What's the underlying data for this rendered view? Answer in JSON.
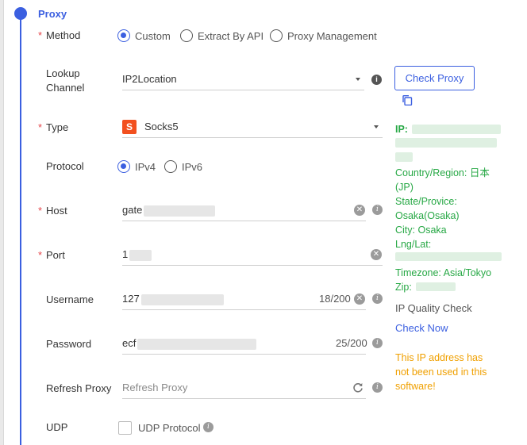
{
  "section": {
    "title": "Proxy"
  },
  "method": {
    "label": "Method",
    "options": [
      "Custom",
      "Extract By API",
      "Proxy Management"
    ],
    "selected": "Custom"
  },
  "lookup": {
    "label_line1": "Lookup",
    "label_line2": "Channel",
    "value": "IP2Location"
  },
  "check_proxy_label": "Check Proxy",
  "type": {
    "label": "Type",
    "badge": "S",
    "value": "Socks5"
  },
  "protocol": {
    "label": "Protocol",
    "options": [
      "IPv4",
      "IPv6"
    ],
    "selected": "IPv4"
  },
  "host": {
    "label": "Host",
    "value_prefix": "gate"
  },
  "port": {
    "label": "Port",
    "value_prefix": "1"
  },
  "username": {
    "label": "Username",
    "value_prefix": "127",
    "counter": "18/200"
  },
  "password": {
    "label": "Password",
    "value_prefix": "ecf",
    "counter": "25/200"
  },
  "refresh": {
    "label": "Refresh Proxy",
    "placeholder": "Refresh Proxy"
  },
  "udp": {
    "label": "UDP",
    "checkbox_label": "UDP Protocol"
  },
  "result": {
    "ip_label": "IP:",
    "country_label": "Country/Region:",
    "country_value": "日本",
    "country_code": "(JP)",
    "state_label": "State/Provice:",
    "state_value": "Osaka(Osaka)",
    "city": "City: Osaka",
    "lnglat_label": "Lng/Lat:",
    "timezone": "Timezone:  Asia/Tokyo",
    "zip_label": "Zip:",
    "quality_label": "IP Quality Check",
    "check_now": "Check Now",
    "warning_line1": "This IP address has",
    "warning_line2": "not been used in this",
    "warning_line3": "software!"
  },
  "colors": {
    "accent": "#3b5fe0",
    "success": "#27a845",
    "warning": "#f0a000",
    "required": "#e5484d",
    "socks_badge": "#f2501f"
  }
}
